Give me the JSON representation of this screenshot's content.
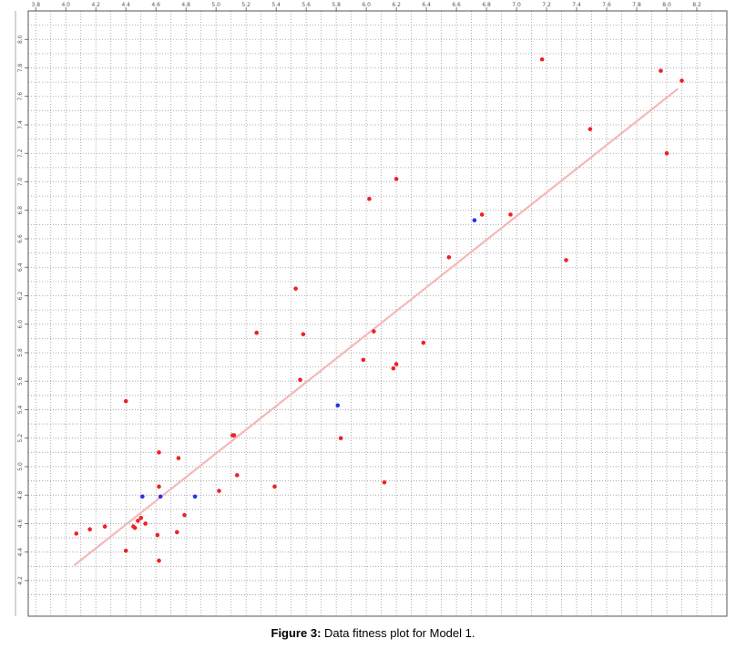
{
  "caption": {
    "label": "Figure 3:",
    "text": " Data fitness plot for Model 1."
  },
  "chart_data": {
    "type": "scatter",
    "title": "",
    "xlabel": "",
    "ylabel": "",
    "xlim": [
      3.75,
      8.4
    ],
    "ylim": [
      3.95,
      8.2
    ],
    "x_ticks": [
      3.8,
      4.0,
      4.2,
      4.4,
      4.6,
      4.8,
      5.0,
      5.2,
      5.4,
      5.6,
      5.8,
      6.0,
      6.2,
      6.4,
      6.6,
      6.8,
      7.0,
      7.2,
      7.4,
      7.6,
      7.8,
      8.0,
      8.2
    ],
    "y_ticks": [
      4.2,
      4.4,
      4.6,
      4.8,
      5.0,
      5.2,
      5.4,
      5.6,
      5.8,
      6.0,
      6.2,
      6.4,
      6.6,
      6.8,
      7.0,
      7.2,
      7.4,
      7.6,
      7.8,
      8.0
    ],
    "grid": true,
    "colors": {
      "training": "#ee2222",
      "test": "#2233ee",
      "fit_line": "#f4b8b8",
      "grid": "#9a9a9a",
      "frame": "#555555"
    },
    "series": [
      {
        "values": [
          [
            4.07,
            4.53
          ],
          [
            4.16,
            4.56
          ],
          [
            4.26,
            4.58
          ],
          [
            4.4,
            5.46
          ],
          [
            4.4,
            4.41
          ],
          [
            4.45,
            4.58
          ],
          [
            4.46,
            4.57
          ],
          [
            4.48,
            4.62
          ],
          [
            4.5,
            4.64
          ],
          [
            4.53,
            4.6
          ],
          [
            4.61,
            4.52
          ],
          [
            4.62,
            5.1
          ],
          [
            4.62,
            4.34
          ],
          [
            4.62,
            4.86
          ],
          [
            4.74,
            4.54
          ],
          [
            4.75,
            5.06
          ],
          [
            4.79,
            4.66
          ],
          [
            5.02,
            4.83
          ],
          [
            5.11,
            5.22
          ],
          [
            5.12,
            5.22
          ],
          [
            5.14,
            4.94
          ],
          [
            5.27,
            5.94
          ],
          [
            5.39,
            4.86
          ],
          [
            5.53,
            6.25
          ],
          [
            5.56,
            5.61
          ],
          [
            5.58,
            5.93
          ],
          [
            5.83,
            5.2
          ],
          [
            5.98,
            5.75
          ],
          [
            6.02,
            6.88
          ],
          [
            6.05,
            5.95
          ],
          [
            6.12,
            4.89
          ],
          [
            6.18,
            5.69
          ],
          [
            6.2,
            5.72
          ],
          [
            6.2,
            7.02
          ],
          [
            6.38,
            5.87
          ],
          [
            6.55,
            6.47
          ],
          [
            6.77,
            6.77
          ],
          [
            6.96,
            6.77
          ],
          [
            7.17,
            7.86
          ],
          [
            7.33,
            6.45
          ],
          [
            7.49,
            7.37
          ],
          [
            7.96,
            7.78
          ],
          [
            8.0,
            7.2
          ],
          [
            8.1,
            7.71
          ]
        ]
      },
      {
        "values": [
          [
            4.51,
            4.79
          ],
          [
            4.63,
            4.79
          ],
          [
            4.86,
            4.79
          ],
          [
            5.81,
            5.43
          ],
          [
            6.72,
            6.73
          ]
        ]
      }
    ],
    "fit_line": {
      "x": [
        4.06,
        8.07
      ],
      "y": [
        4.31,
        7.65
      ]
    }
  }
}
